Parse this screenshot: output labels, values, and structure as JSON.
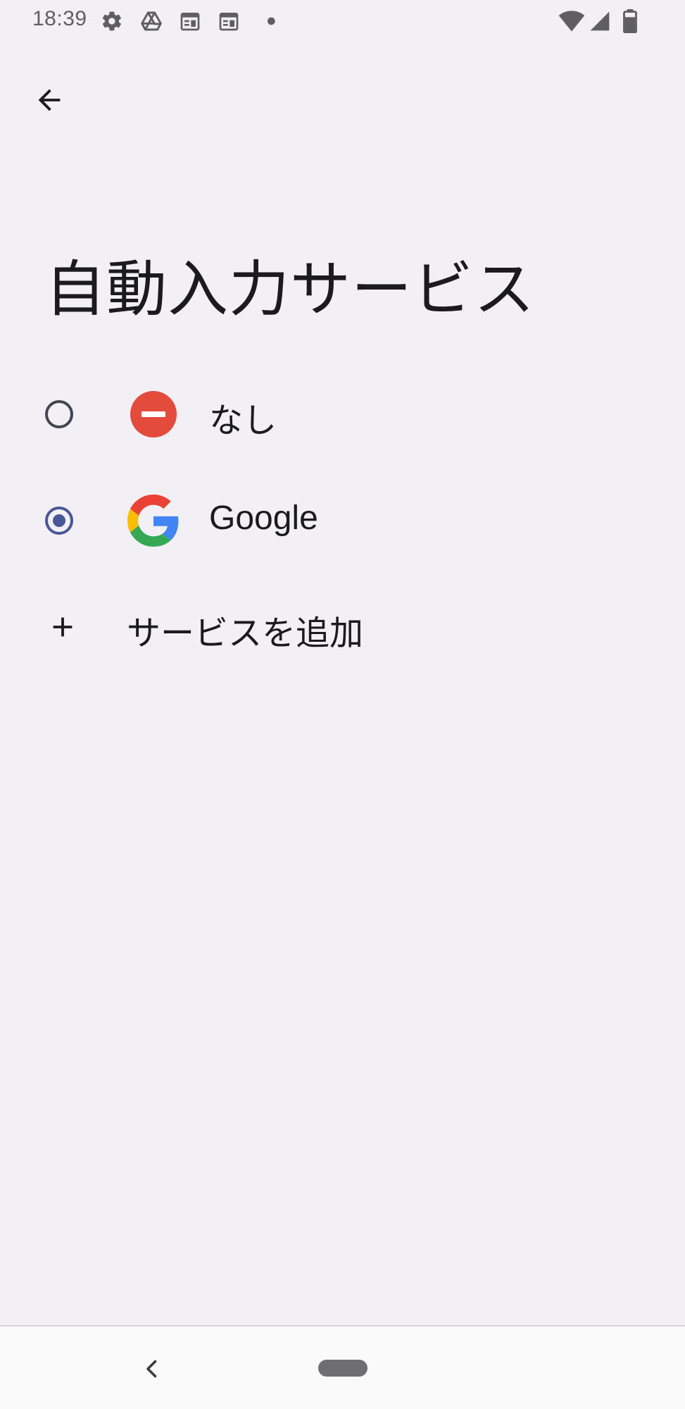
{
  "status_bar": {
    "time": "18:39",
    "left_icons": [
      "gear-icon",
      "drive-icon",
      "calendar-icon",
      "calendar-icon",
      "dot-icon"
    ],
    "right_icons": [
      "wifi-icon",
      "cellular-signal-icon",
      "battery-icon"
    ]
  },
  "header": {
    "back_icon": "arrow-back-icon"
  },
  "page": {
    "title": "自動入力サービス"
  },
  "options": [
    {
      "label": "なし",
      "icon": "no-entry-icon",
      "selected": false
    },
    {
      "label": "Google",
      "icon": "google-logo-icon",
      "selected": true
    }
  ],
  "add_service": {
    "label": "サービスを追加",
    "icon": "plus-icon"
  },
  "nav_bar": {
    "back_icon": "chevron-left-icon",
    "home_icon": "home-pill-icon"
  },
  "colors": {
    "background": "#f2f0f4",
    "radio_selected": "#4a5796",
    "no_entry_red": "#e34b3c",
    "nav_background": "#fafafa"
  }
}
